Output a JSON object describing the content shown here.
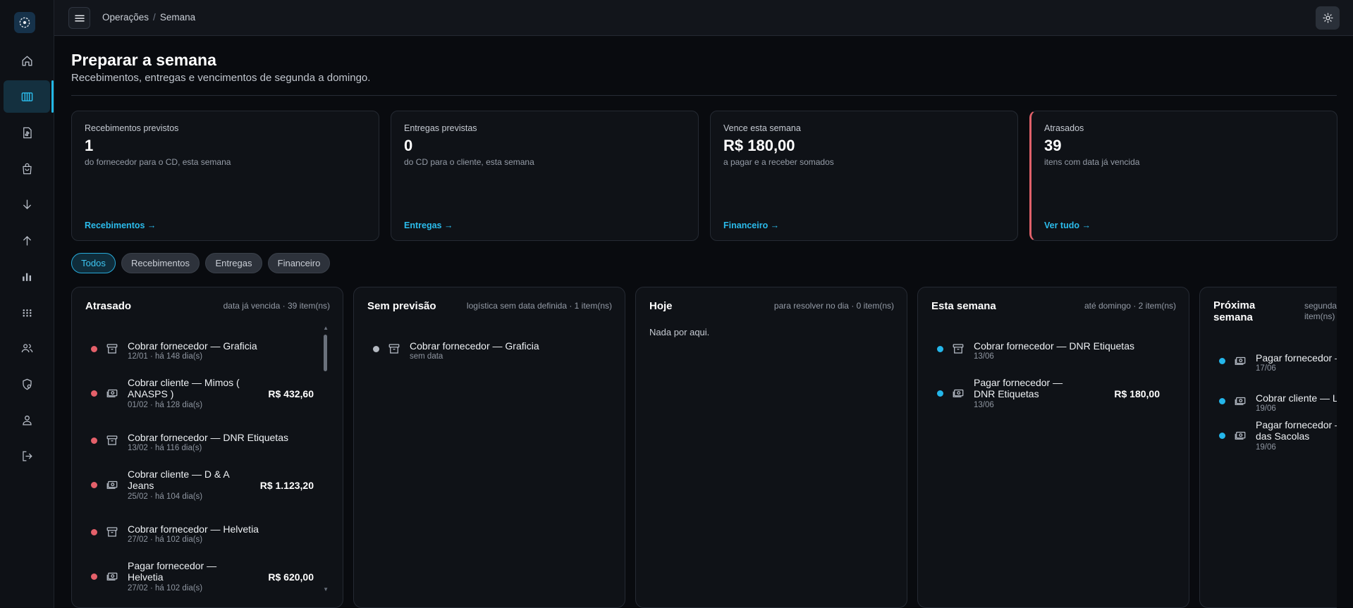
{
  "topbar": {
    "breadcrumb": [
      "Operações",
      "Semana"
    ]
  },
  "page": {
    "title": "Preparar a semana",
    "subtitle": "Recebimentos, entregas e vencimentos de segunda a domingo."
  },
  "summary_cards": [
    {
      "label": "Recebimentos previstos",
      "value": "1",
      "desc": "do fornecedor para o CD, esta semana",
      "link": "Recebimentos →"
    },
    {
      "label": "Entregas previstas",
      "value": "0",
      "desc": "do CD para o cliente, esta semana",
      "link": "Entregas →"
    },
    {
      "label": "Vence esta semana",
      "value": "R$ 180,00",
      "desc": "a pagar e a receber somados",
      "link": "Financeiro →"
    },
    {
      "label": "Atrasados",
      "value": "39",
      "desc": "itens com data já vencida",
      "link": "Ver tudo →"
    }
  ],
  "filters": {
    "active": "Todos",
    "options": [
      "Todos",
      "Recebimentos",
      "Entregas",
      "Financeiro"
    ]
  },
  "columns": [
    {
      "title": "Atrasado",
      "meta": "data já vencida · 39 item(ns)",
      "items": [
        {
          "icon": "box-icon",
          "name": "Cobrar fornecedor — Graficia",
          "date": "12/01 · há 148 dia(s)",
          "amount": ""
        },
        {
          "icon": "cash-icon",
          "name": "Cobrar cliente — Mimos ( ANASPS )",
          "date": "01/02 · há 128 dia(s)",
          "amount": "R$ 432,60"
        },
        {
          "icon": "box-icon",
          "name": "Cobrar fornecedor — DNR Etiquetas",
          "date": "13/02 · há 116 dia(s)",
          "amount": ""
        },
        {
          "icon": "cash-icon",
          "name": "Cobrar cliente — D & A Jeans",
          "date": "25/02 · há 104 dia(s)",
          "amount": "R$ 1.123,20"
        },
        {
          "icon": "box-icon",
          "name": "Cobrar fornecedor — Helvetia",
          "date": "27/02 · há 102 dia(s)",
          "amount": ""
        },
        {
          "icon": "cash-icon",
          "name": "Pagar fornecedor — Helvetia",
          "date": "27/02 · há 102 dia(s)",
          "amount": "R$ 620,00"
        }
      ]
    },
    {
      "title": "Sem previsão",
      "meta": "logística sem data definida · 1 item(ns)",
      "items": [
        {
          "icon": "box-icon",
          "name": "Cobrar fornecedor — Graficia",
          "date": "sem data",
          "amount": ""
        }
      ]
    },
    {
      "title": "Hoje",
      "meta": "para resolver no dia · 0 item(ns)",
      "empty": "Nada por aqui.",
      "items": []
    },
    {
      "title": "Esta semana",
      "meta": "até domingo · 2 item(ns)",
      "items": [
        {
          "icon": "box-icon",
          "name": "Cobrar fornecedor — DNR Etiquetas",
          "date": "13/06",
          "amount": ""
        },
        {
          "icon": "cash-icon",
          "name": "Pagar fornecedor — DNR Etiquetas",
          "date": "13/06",
          "amount": "R$ 180,00"
        }
      ]
    },
    {
      "title": "Próxima semana",
      "meta": "segunda item(ns)",
      "items": [
        {
          "icon": "cash-icon",
          "name": "Pagar fornecedor –",
          "date": "17/06",
          "amount": ""
        },
        {
          "icon": "cash-icon",
          "name": "Cobrar cliente — L",
          "date": "19/06",
          "amount": ""
        },
        {
          "icon": "cash-icon",
          "name": "Pagar fornecedor – das Sacolas",
          "date": "19/06",
          "amount": ""
        }
      ]
    }
  ],
  "colors": {
    "accent": "#22b8e6",
    "overdue": "#e4606a",
    "background": "#090b0f",
    "card": "#0f1217"
  }
}
